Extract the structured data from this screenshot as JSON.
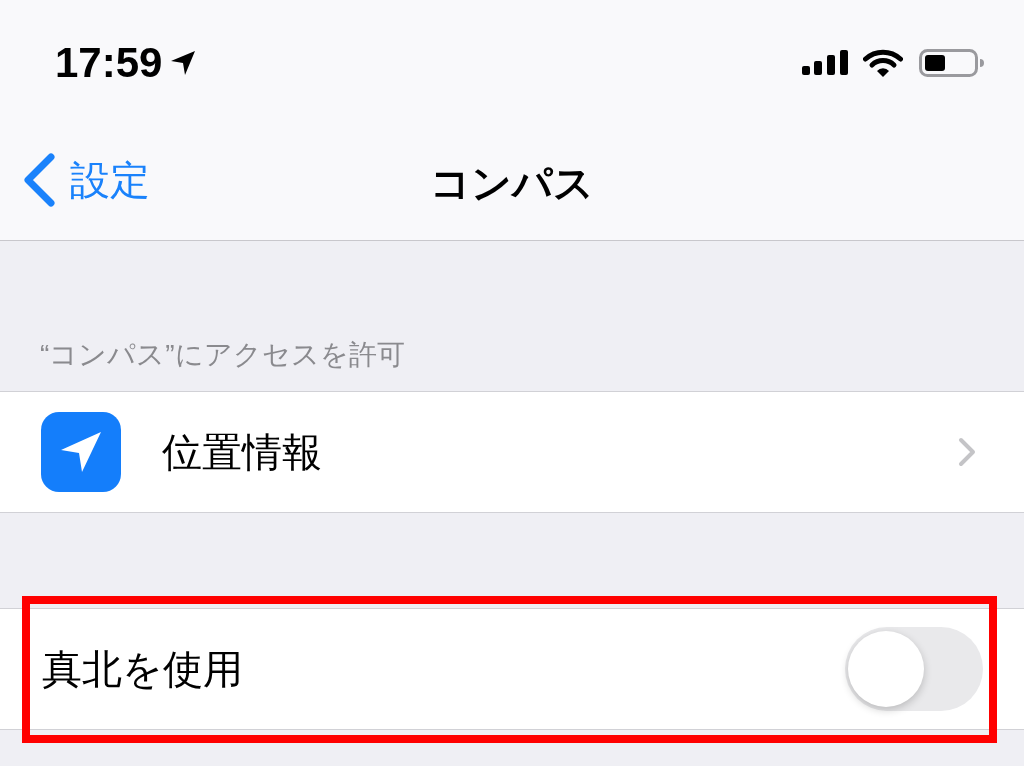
{
  "status_bar": {
    "time": "17:59"
  },
  "nav_bar": {
    "back": "設定",
    "title": "コンパス"
  },
  "sections": [
    {
      "header": "“コンパス”にアクセスを許可",
      "rows": [
        {
          "kind": "link",
          "label": "位置情報",
          "highlighted": false
        }
      ]
    },
    {
      "rows": [
        {
          "kind": "toggle",
          "label": "真北を使用",
          "on": false,
          "highlighted": true
        }
      ]
    }
  ]
}
